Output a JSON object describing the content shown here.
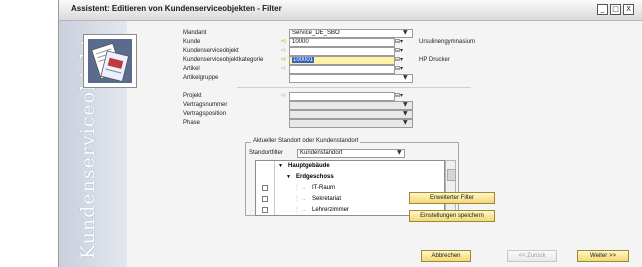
{
  "window": {
    "title": "Assistent: Editieren von Kundenserviceobjekten - Filter",
    "controls": [
      "_",
      "□",
      "X"
    ]
  },
  "side_panel": {
    "vertical_text": "Kundenserviceobjekt"
  },
  "form": {
    "mandant": {
      "label": "Mandant",
      "value": "Service_DE_SBO"
    },
    "kunde": {
      "label": "Kunde",
      "value": "10000",
      "hint": "Ursulinengymnasium"
    },
    "kundenserviceobjekt": {
      "label": "Kundenserviceobjekt",
      "value": ""
    },
    "kategorie": {
      "label": "Kundenserviceobjektkategorie",
      "value": "100001",
      "hint": "HP Drucker"
    },
    "artikel": {
      "label": "Artikel",
      "value": ""
    },
    "artikelgruppe": {
      "label": "Artikelgruppe",
      "value": ""
    },
    "projekt": {
      "label": "Projekt",
      "value": ""
    },
    "vertragsnummer": {
      "label": "Vertragsnummer",
      "value": ""
    },
    "vertragsposition": {
      "label": "Vertragsposition",
      "value": ""
    },
    "phase": {
      "label": "Phase",
      "value": ""
    }
  },
  "location_group": {
    "title": "Aktueller Standort oder Kundenstandort",
    "filter_label": "Standortfilter",
    "filter_value": "Kundenstandort",
    "tree": [
      {
        "label": "Hauptgebäude",
        "level": 0,
        "bold": true
      },
      {
        "label": "Erdgeschoss",
        "level": 1,
        "bold": true
      },
      {
        "label": "IT-Raum",
        "level": 2,
        "bold": false
      },
      {
        "label": "Sekretariat",
        "level": 2,
        "bold": false
      },
      {
        "label": "Lehrerzimmer",
        "level": 2,
        "bold": false
      }
    ]
  },
  "buttons": {
    "extended_filter": "Erweiterter Filter",
    "save_settings": "Einstellungen speichern",
    "cancel": "Abbrechen",
    "back": "<< Zurück",
    "next": "Weiter >>"
  },
  "colors": {
    "button_fill": "#f3d875",
    "highlight_field": "#fff2a6",
    "link_arrow": "#e0a21f",
    "side_panel": "#c9d0dc"
  },
  "icons": [
    "window-minimize-icon",
    "window-maximize-icon",
    "window-close-icon",
    "service-object-icon",
    "link-arrow-icon",
    "dropdown-arrow-icon",
    "selection-list-icon"
  ]
}
